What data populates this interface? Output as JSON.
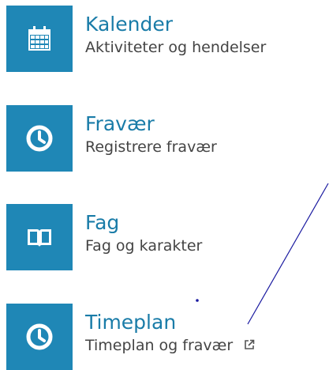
{
  "menu": {
    "items": [
      {
        "title": "Kalender",
        "subtitle": "Aktiviteter og hendelser",
        "icon": "calendar-icon"
      },
      {
        "title": "Fravær",
        "subtitle": "Registrere fravær",
        "icon": "clock-icon"
      },
      {
        "title": "Fag",
        "subtitle": "Fag og karakter",
        "icon": "book-icon"
      },
      {
        "title": "Timeplan",
        "subtitle": "Timeplan og fravær",
        "icon": "clock-icon",
        "external": true
      }
    ]
  },
  "colors": {
    "tile": "#1f87b6",
    "title": "#1a7ca8",
    "subtitle": "#444444",
    "annotation_line": "#1a1aa0"
  },
  "annotation": {
    "line": "diagonal pen stroke from bottom-left of Timeplan link toward top-right",
    "dot": "small dark blue dot between Fag and Timeplan"
  }
}
